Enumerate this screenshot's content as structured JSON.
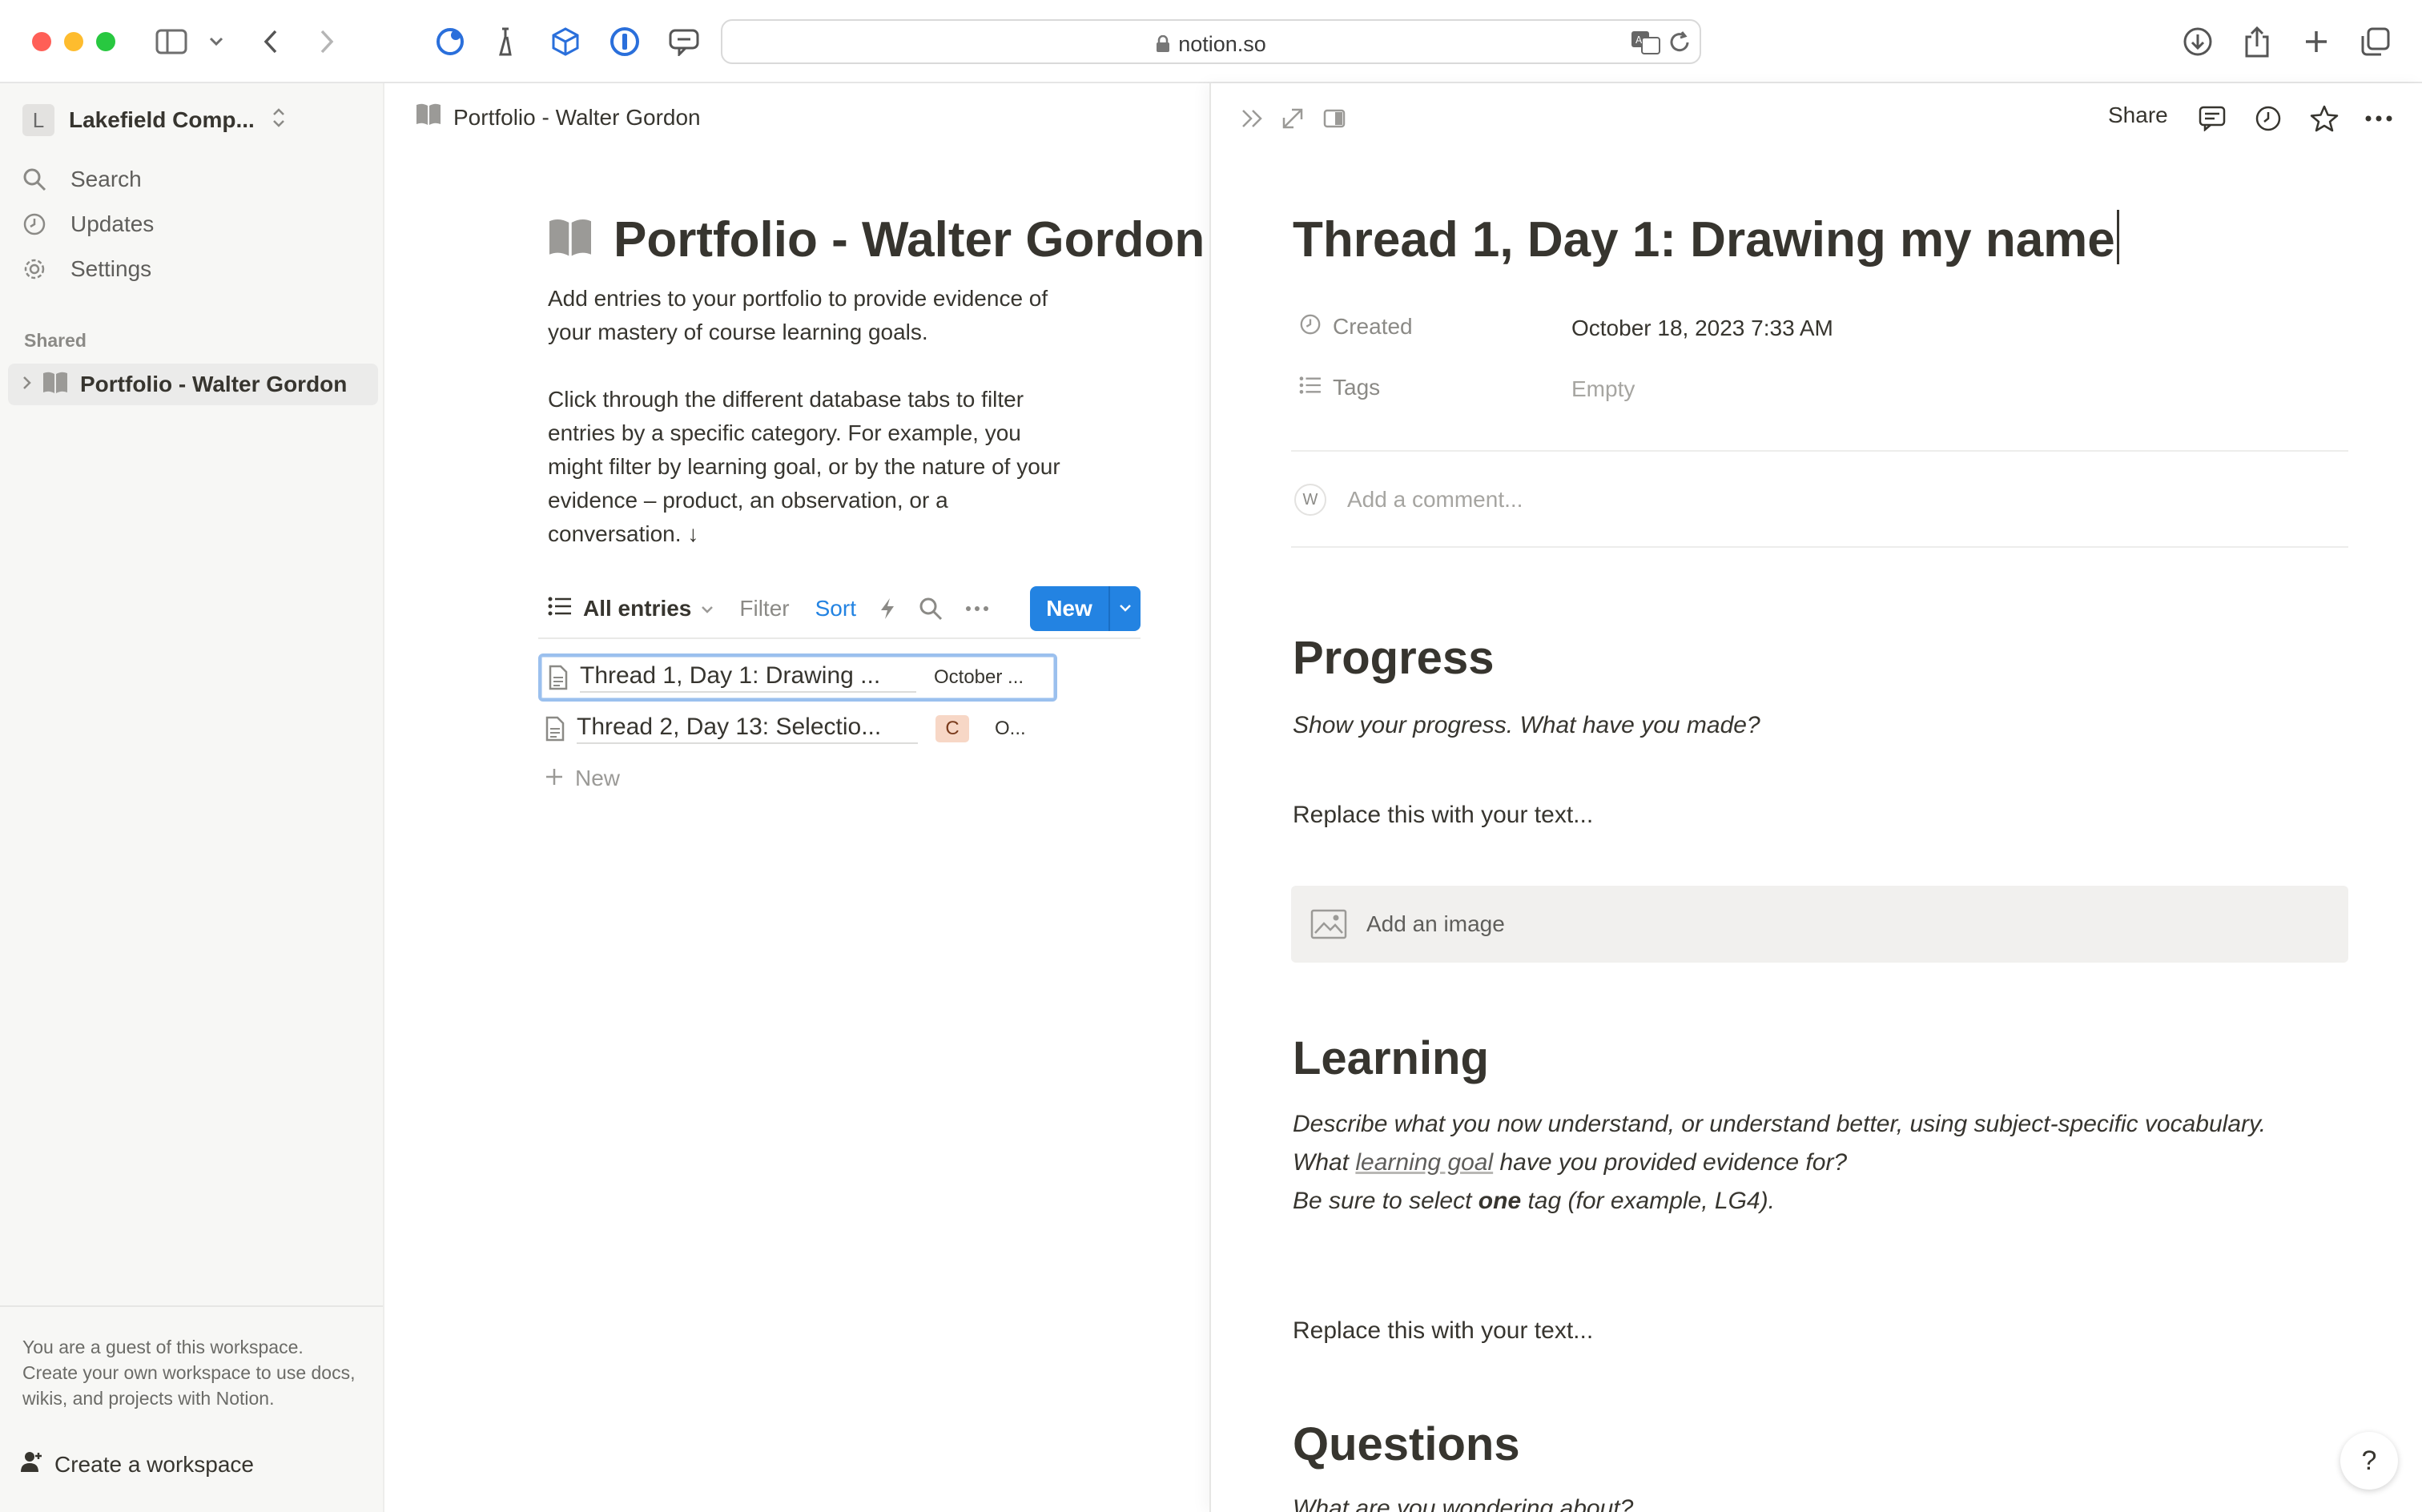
{
  "browser": {
    "url": "notion.so"
  },
  "sidebar": {
    "workspace_initial": "L",
    "workspace_name": "Lakefield Comp...",
    "items": [
      {
        "label": "Search",
        "icon": "search-icon"
      },
      {
        "label": "Updates",
        "icon": "clock-icon"
      },
      {
        "label": "Settings",
        "icon": "gear-icon"
      }
    ],
    "shared_heading": "Shared",
    "shared_page": "Portfolio - Walter Gordon",
    "guest_note": "You are a guest of this workspace. Create your own workspace to use docs, wikis, and projects with Notion.",
    "create_workspace": "Create a workspace"
  },
  "main": {
    "breadcrumb": "Portfolio - Walter Gordon",
    "title": "Portfolio - Walter Gordon",
    "description": [
      "Add entries to your portfolio to provide evidence of your mastery of course learning goals.",
      "Click through the different database tabs to filter entries by a specific category. For example, you might filter by learning goal, or by the nature of your evidence – product, an observation, or a conversation. ↓"
    ],
    "toolbar": {
      "view": "All entries",
      "filter": "Filter",
      "sort": "Sort",
      "new": "New"
    },
    "rows": [
      {
        "name": "Thread 1, Day 1: Drawing ...",
        "date": "October ..."
      },
      {
        "name": "Thread 2, Day 13: Selectio...",
        "badge": "C",
        "extra": "O..."
      }
    ],
    "new_row": "New"
  },
  "peek": {
    "share": "Share",
    "title": "Thread 1, Day 1: Drawing my name",
    "props": {
      "created_label": "Created",
      "created_value": "October 18, 2023 7:33 AM",
      "tags_label": "Tags",
      "tags_value": "Empty"
    },
    "comment": {
      "avatar": "W",
      "placeholder": "Add a comment..."
    },
    "progress": {
      "heading": "Progress",
      "prompt": "Show your progress. What have you made?",
      "placeholder": "Replace this with your text...",
      "image": "Add an image"
    },
    "learning": {
      "heading": "Learning",
      "line1": "Describe what you now understand, or understand better, using subject-specific vocabulary.",
      "line2_pre": "What ",
      "line2_link": "learning goal",
      "line2_post": " have you provided evidence for?",
      "line3_pre": "Be sure to select ",
      "line3_bold": "one",
      "line3_post": " tag (for example, LG4).",
      "placeholder": "Replace this with your text..."
    },
    "questions": {
      "heading": "Questions",
      "prompt": "What are you wondering about?"
    },
    "help": "?"
  }
}
